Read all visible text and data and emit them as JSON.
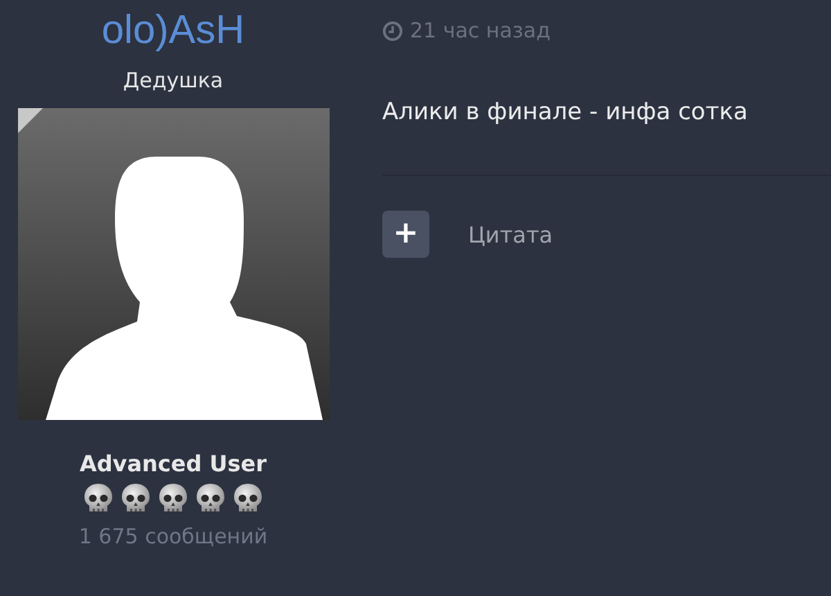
{
  "author": {
    "name": "olo)AsH",
    "title": "Дедушка",
    "rank": "Advanced User",
    "post_count": "1 675 сообщений"
  },
  "post": {
    "time": "21 час назад",
    "text": "Алики в финале - инфа сотка"
  },
  "actions": [
    {
      "icon": "+",
      "label": "Цитата"
    }
  ]
}
